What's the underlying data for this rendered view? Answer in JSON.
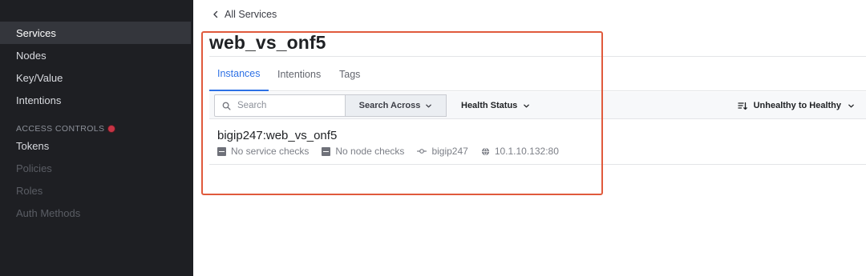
{
  "sidebar": {
    "items": [
      {
        "label": "Services"
      },
      {
        "label": "Nodes"
      },
      {
        "label": "Key/Value"
      },
      {
        "label": "Intentions"
      }
    ],
    "access_controls": {
      "heading": "ACCESS CONTROLS",
      "items": [
        {
          "label": "Tokens"
        },
        {
          "label": "Policies"
        },
        {
          "label": "Roles"
        },
        {
          "label": "Auth Methods"
        }
      ]
    }
  },
  "breadcrumb": {
    "label": "All Services"
  },
  "page": {
    "title": "web_vs_onf5"
  },
  "tabs": [
    {
      "label": "Instances"
    },
    {
      "label": "Intentions"
    },
    {
      "label": "Tags"
    }
  ],
  "filters": {
    "search_placeholder": "Search",
    "search_across": "Search Across",
    "health_status": "Health Status",
    "sort": "Unhealthy to Healthy"
  },
  "instances": [
    {
      "name": "bigip247:web_vs_onf5",
      "service_checks": "No service checks",
      "node_checks": "No node checks",
      "node": "bigip247",
      "address": "10.1.10.132:80"
    }
  ],
  "colors": {
    "sidebar_bg": "#1e1f23",
    "accent": "#2e71e5",
    "highlight": "#e05a3c",
    "alert_dot": "#c73445"
  }
}
